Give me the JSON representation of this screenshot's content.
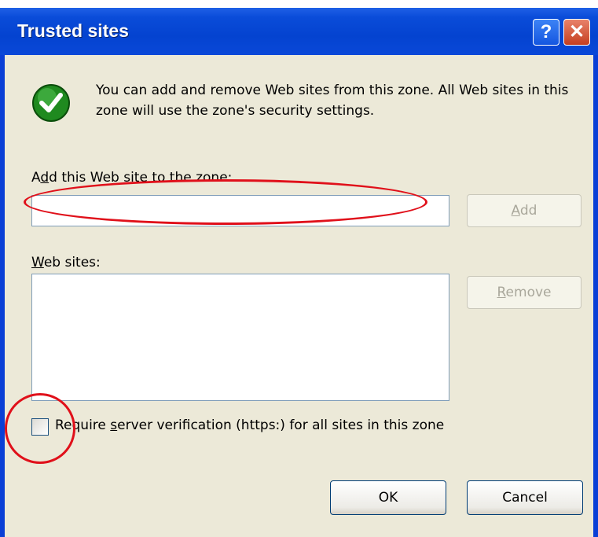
{
  "window": {
    "title": "Trusted sites",
    "help_label": "?",
    "close_label": "✕",
    "icons": {
      "info": "checkmark-shield-icon",
      "help": "help-icon",
      "close": "close-icon"
    }
  },
  "dialog": {
    "info_text": "You can add and remove Web sites from this zone. All Web sites in this zone will use the zone's security settings.",
    "add_label_prefix": "A",
    "add_label_accel": "d",
    "add_label_rest": "d this Web site to the zone:",
    "site_input_value": "",
    "add_button_accel": "A",
    "add_button_rest": "dd",
    "sites_label_accel": "W",
    "sites_label_rest": "eb sites:",
    "sites": [],
    "remove_button_accel": "R",
    "remove_button_rest": "emove",
    "require_prefix": "Require ",
    "require_accel": "s",
    "require_rest": "erver verification (https:) for all sites in this zone",
    "require_checked": false,
    "ok_label": "OK",
    "cancel_label": "Cancel"
  },
  "colors": {
    "title_bar": "#0443d0",
    "dialog_bg": "#ece9d8",
    "annotation": "#e0101a",
    "check_icon": "#1f8a1f"
  }
}
